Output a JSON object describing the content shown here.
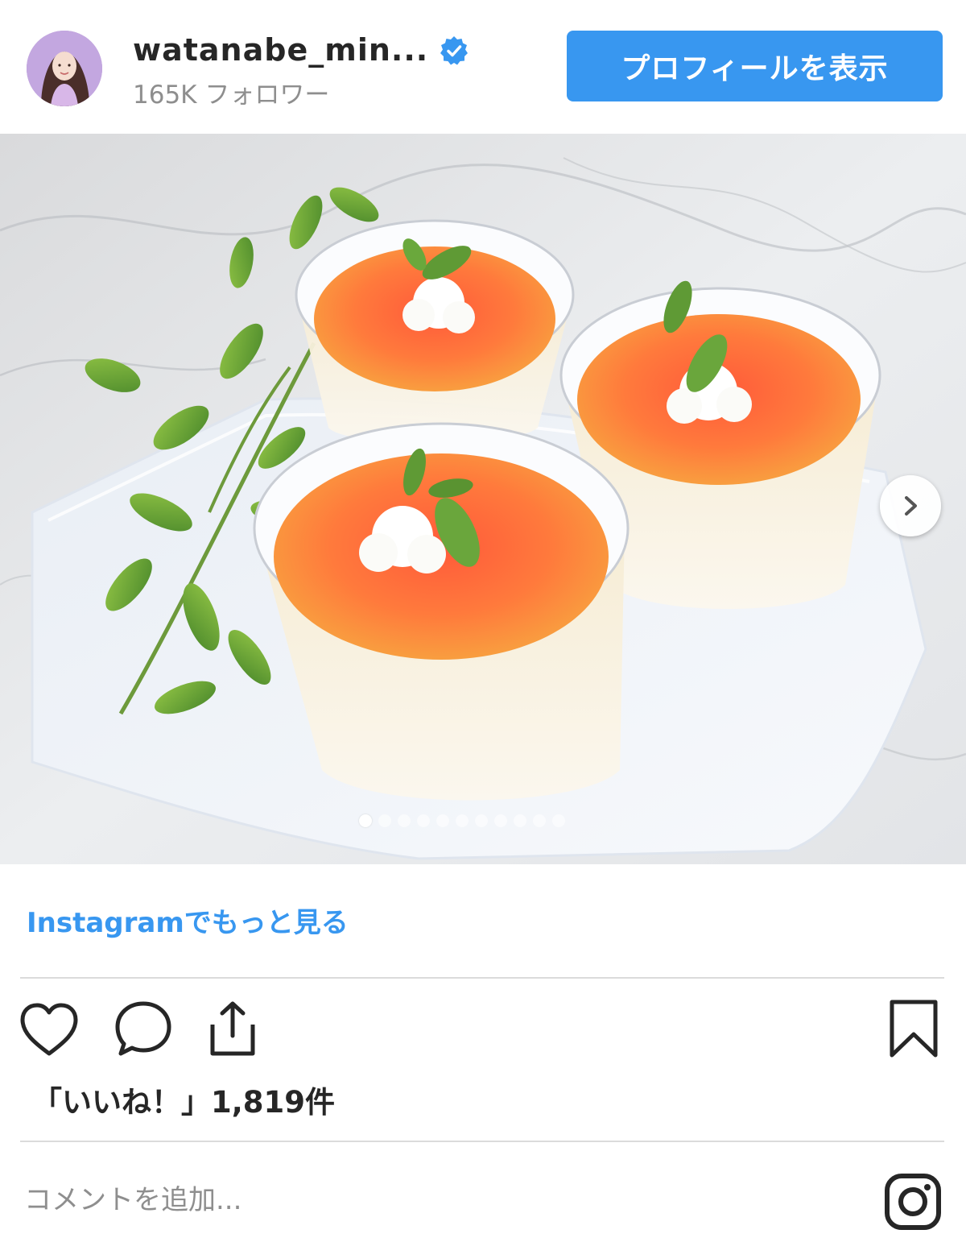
{
  "post": {
    "username": "watanabe_min...",
    "verified": true,
    "followers": "165K フォロワー",
    "profile_button": "プロフィールを表示",
    "carousel": {
      "total": 11,
      "current": 1
    },
    "more_link": "Instagramでもっと見る",
    "likes": "「いいね！」1,819件",
    "comment_placeholder": "コメントを追加..."
  },
  "colors": {
    "accent": "#3897f0",
    "text": "#262626",
    "muted": "#8e8e8e",
    "divider": "#dbdbdb"
  },
  "icons": [
    "verified-badge-icon",
    "chevron-right-icon",
    "heart-icon",
    "comment-icon",
    "share-icon",
    "bookmark-icon",
    "instagram-logo-icon"
  ]
}
